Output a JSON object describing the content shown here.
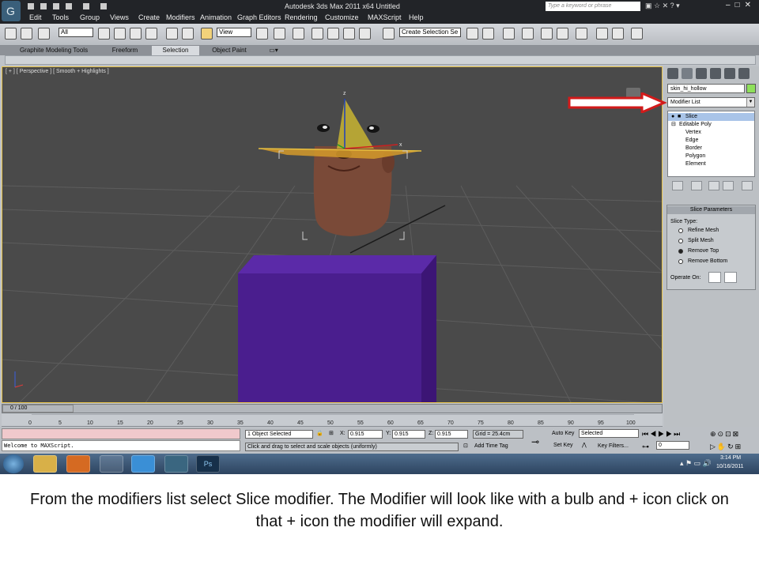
{
  "window": {
    "title": "Autodesk 3ds Max  2011 x64      Untitled",
    "search_placeholder": "Type a keyword or phrase"
  },
  "menu": [
    "Edit",
    "Tools",
    "Group",
    "Views",
    "Create",
    "Modifiers",
    "Animation",
    "Graph Editors",
    "Rendering",
    "Customize",
    "MAXScript",
    "Help"
  ],
  "toolbar": {
    "filter_value": "All",
    "refcoord_value": "View",
    "selection_set_placeholder": "Create Selection Se"
  },
  "ribbon": {
    "tabs": [
      "Graphite Modeling Tools",
      "Freeform",
      "Selection",
      "Object Paint"
    ],
    "active_tab": "Selection"
  },
  "viewport": {
    "label": "[ + ] [ Perspective ] [ Smooth + Highlights ]",
    "gizmo_z": "z",
    "gizmo_x": "x",
    "border_color": "#e7c34a",
    "box_color": "#4a1e8e"
  },
  "command_panel": {
    "object_name": "skin_hi_hollow",
    "object_color": "#8ee05a",
    "modifier_list_label": "Modifier List",
    "stack": [
      {
        "label": "Slice",
        "level": 0,
        "selected": true
      },
      {
        "label": "Editable Poly",
        "level": 0,
        "selected": false
      },
      {
        "label": "Vertex",
        "level": 1,
        "selected": false
      },
      {
        "label": "Edge",
        "level": 1,
        "selected": false
      },
      {
        "label": "Border",
        "level": 1,
        "selected": false
      },
      {
        "label": "Polygon",
        "level": 1,
        "selected": false
      },
      {
        "label": "Element",
        "level": 1,
        "selected": false
      }
    ],
    "slice_params": {
      "title": "Slice Parameters",
      "type_label": "Slice Type:",
      "options": [
        "Refine Mesh",
        "Split Mesh",
        "Remove Top",
        "Remove Bottom"
      ],
      "selected": "Remove Top",
      "operate_on": "Operate On:"
    }
  },
  "timeline": {
    "frame_display": "0 / 100",
    "ticks": [
      "0",
      "5",
      "10",
      "15",
      "20",
      "25",
      "30",
      "35",
      "40",
      "45",
      "50",
      "55",
      "60",
      "65",
      "70",
      "75",
      "80",
      "85",
      "90",
      "95",
      "100"
    ]
  },
  "status": {
    "selection": "1 Object Selected",
    "prompt": "Click and drag to select and scale objects (uniformly)",
    "x_label": "X:",
    "x_value": "0.915",
    "y_label": "Y:",
    "y_value": "0.915",
    "z_label": "Z:",
    "z_value": "0.915",
    "grid": "Grid = 25.4cm",
    "add_time_tag": "Add Time Tag",
    "auto_key": "Auto Key",
    "set_key": "Set Key",
    "key_mode_value": "Selected",
    "key_filters": "Key Filters...",
    "frame_spinner": "0",
    "maxscript_output": "Welcome to MAXScript."
  },
  "taskbar": {
    "time": "3:14 PM",
    "date": "10/16/2011",
    "app_ps_label": "Ps"
  },
  "caption": "From the modifiers list select Slice modifier. The Modifier will look like with a bulb and + icon click on that + icon the modifier will expand."
}
